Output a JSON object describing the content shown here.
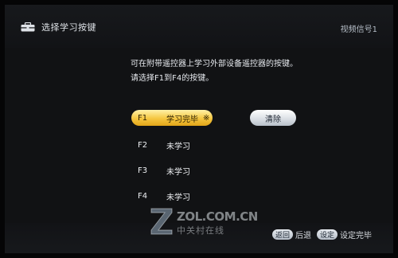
{
  "header": {
    "title": "选择学习按键",
    "signal": "视频信号1",
    "icon": "toolbox-icon"
  },
  "instructions": {
    "line1": "可在附带遥控器上学习外部设备遥控器的按键。",
    "line2": "请选择F1到F4的按键。"
  },
  "keys": [
    {
      "key": "F1",
      "status": "学习完毕",
      "mark": "※",
      "selected": true
    },
    {
      "key": "F2",
      "status": "未学习",
      "selected": false
    },
    {
      "key": "F3",
      "status": "未学习",
      "selected": false
    },
    {
      "key": "F4",
      "status": "未学习",
      "selected": false
    }
  ],
  "clear_button": {
    "label": "清除"
  },
  "watermark": {
    "site": "ZOL.COM.CN",
    "name": "中关村在线"
  },
  "footer": {
    "back_key": "返回",
    "back_label": "后退",
    "set_key": "设定",
    "set_label": "设定完毕"
  },
  "colors": {
    "selected_gradient_top": "#fff1a8",
    "selected_gradient_bottom": "#e2a519",
    "background": "#111214"
  }
}
